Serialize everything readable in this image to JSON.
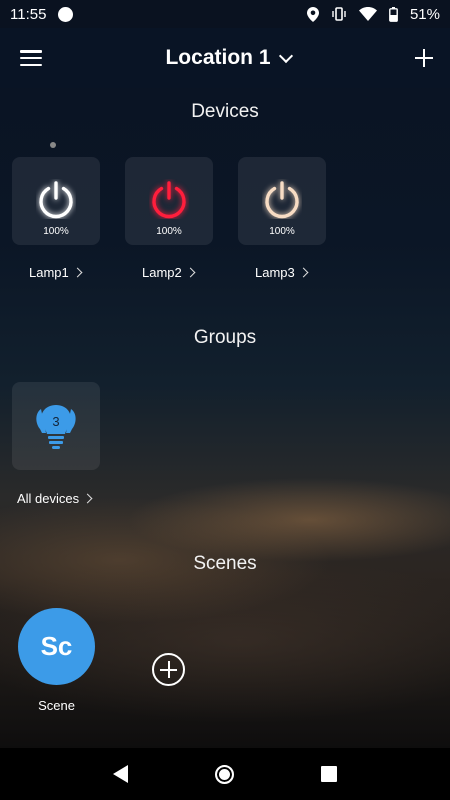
{
  "status_bar": {
    "time": "11:55",
    "battery": "51%",
    "icons": [
      "location-icon",
      "vibrate-icon",
      "wifi-icon",
      "battery-icon"
    ]
  },
  "header": {
    "location": "Location 1",
    "menu_icon": "hamburger-menu-icon",
    "add_icon": "plus-icon"
  },
  "devices": {
    "title": "Devices",
    "items": [
      {
        "label": "Lamp1",
        "level": "100%",
        "color": "#ffffff"
      },
      {
        "label": "Lamp2",
        "level": "100%",
        "color": "#ff1e3c"
      },
      {
        "label": "Lamp3",
        "level": "100%",
        "color": "#f7dcc4"
      }
    ]
  },
  "groups": {
    "title": "Groups",
    "items": [
      {
        "label": "All devices",
        "count": "3",
        "color": "#3c9be8"
      }
    ]
  },
  "scenes": {
    "title": "Scenes",
    "items": [
      {
        "label": "Scene",
        "initials": "Sc",
        "color": "#3c9be8"
      }
    ]
  },
  "nav": {
    "back_icon": "back-triangle-icon",
    "home_icon": "home-circle-icon",
    "recents_icon": "recents-square-icon"
  }
}
